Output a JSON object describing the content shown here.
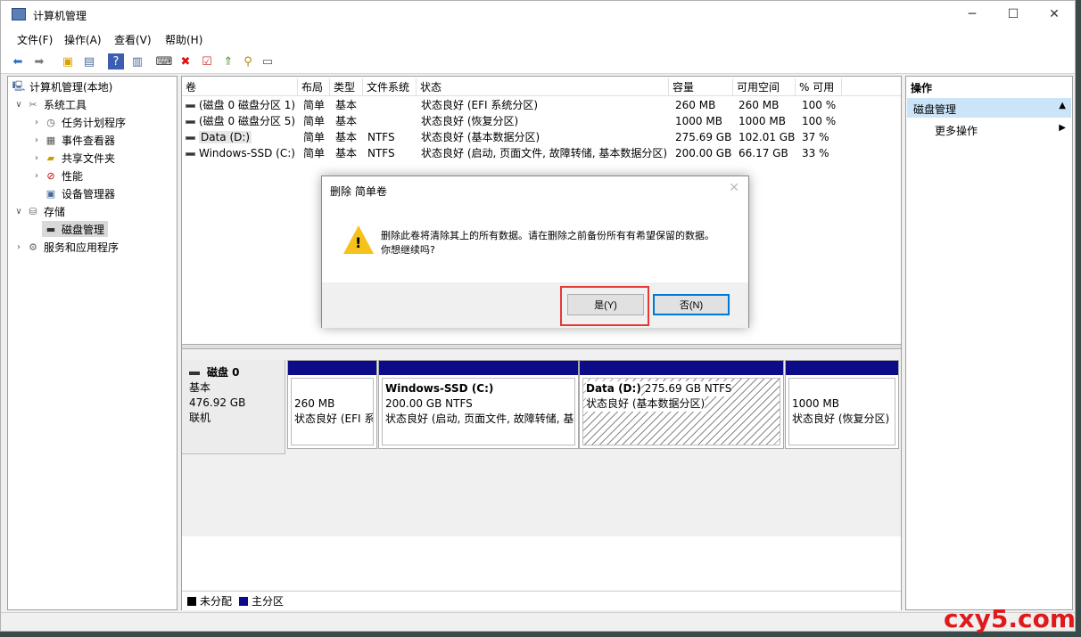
{
  "window": {
    "title": "计算机管理",
    "minimize": "─",
    "maximize": "☐",
    "close": "✕"
  },
  "menu": [
    "文件(F)",
    "操作(A)",
    "查看(V)",
    "帮助(H)"
  ],
  "tree": {
    "root": "计算机管理(本地)",
    "system_tools": "系统工具",
    "task_scheduler": "任务计划程序",
    "event_viewer": "事件查看器",
    "shared_folders": "共享文件夹",
    "performance": "性能",
    "device_manager": "设备管理器",
    "storage": "存储",
    "disk_management": "磁盘管理",
    "services_apps": "服务和应用程序"
  },
  "table": {
    "headers": [
      "卷",
      "布局",
      "类型",
      "文件系统",
      "状态",
      "容量",
      "可用空间",
      "% 可用"
    ],
    "rows": [
      {
        "vol": "(磁盘 0 磁盘分区 1)",
        "layout": "简单",
        "type": "基本",
        "fs": "",
        "status": "状态良好 (EFI 系统分区)",
        "cap": "260 MB",
        "free": "260 MB",
        "pct": "100 %"
      },
      {
        "vol": "(磁盘 0 磁盘分区 5)",
        "layout": "简单",
        "type": "基本",
        "fs": "",
        "status": "状态良好 (恢复分区)",
        "cap": "1000 MB",
        "free": "1000 MB",
        "pct": "100 %"
      },
      {
        "vol": "Data (D:)",
        "layout": "简单",
        "type": "基本",
        "fs": "NTFS",
        "status": "状态良好 (基本数据分区)",
        "cap": "275.69 GB",
        "free": "102.01 GB",
        "pct": "37 %"
      },
      {
        "vol": "Windows-SSD (C:)",
        "layout": "简单",
        "type": "基本",
        "fs": "NTFS",
        "status": "状态良好 (启动, 页面文件, 故障转储, 基本数据分区)",
        "cap": "200.00 GB",
        "free": "66.17 GB",
        "pct": "33 %"
      }
    ]
  },
  "disk": {
    "name": "磁盘 0",
    "type": "基本",
    "size": "476.92 GB",
    "state": "联机"
  },
  "partitions": [
    {
      "title": "",
      "size": "260 MB",
      "status": "状态良好 (EFI 系"
    },
    {
      "title": "Windows-SSD  (C:)",
      "size": "200.00 GB NTFS",
      "status": "状态良好 (启动, 页面文件, 故障转储, 基"
    },
    {
      "title": "Data  (D:)",
      "size": "275.69 GB NTFS",
      "status": "状态良好 (基本数据分区)"
    },
    {
      "title": "",
      "size": "1000 MB",
      "status": "状态良好 (恢复分区)"
    }
  ],
  "legend": {
    "unallocated": "未分配",
    "primary": "主分区"
  },
  "actions": {
    "header": "操作",
    "section": "磁盘管理",
    "more": "更多操作"
  },
  "dialog": {
    "title": "删除 简单卷",
    "message": "删除此卷将清除其上的所有数据。请在删除之前备份所有有希望保留的数据。你想继续吗?",
    "yes": "是(Y)",
    "no": "否(N)"
  },
  "watermark": "cxy5.com",
  "colors": {
    "primary_partition": "#0c0c88",
    "highlight": "#e53935",
    "selection": "#cce4f7"
  }
}
